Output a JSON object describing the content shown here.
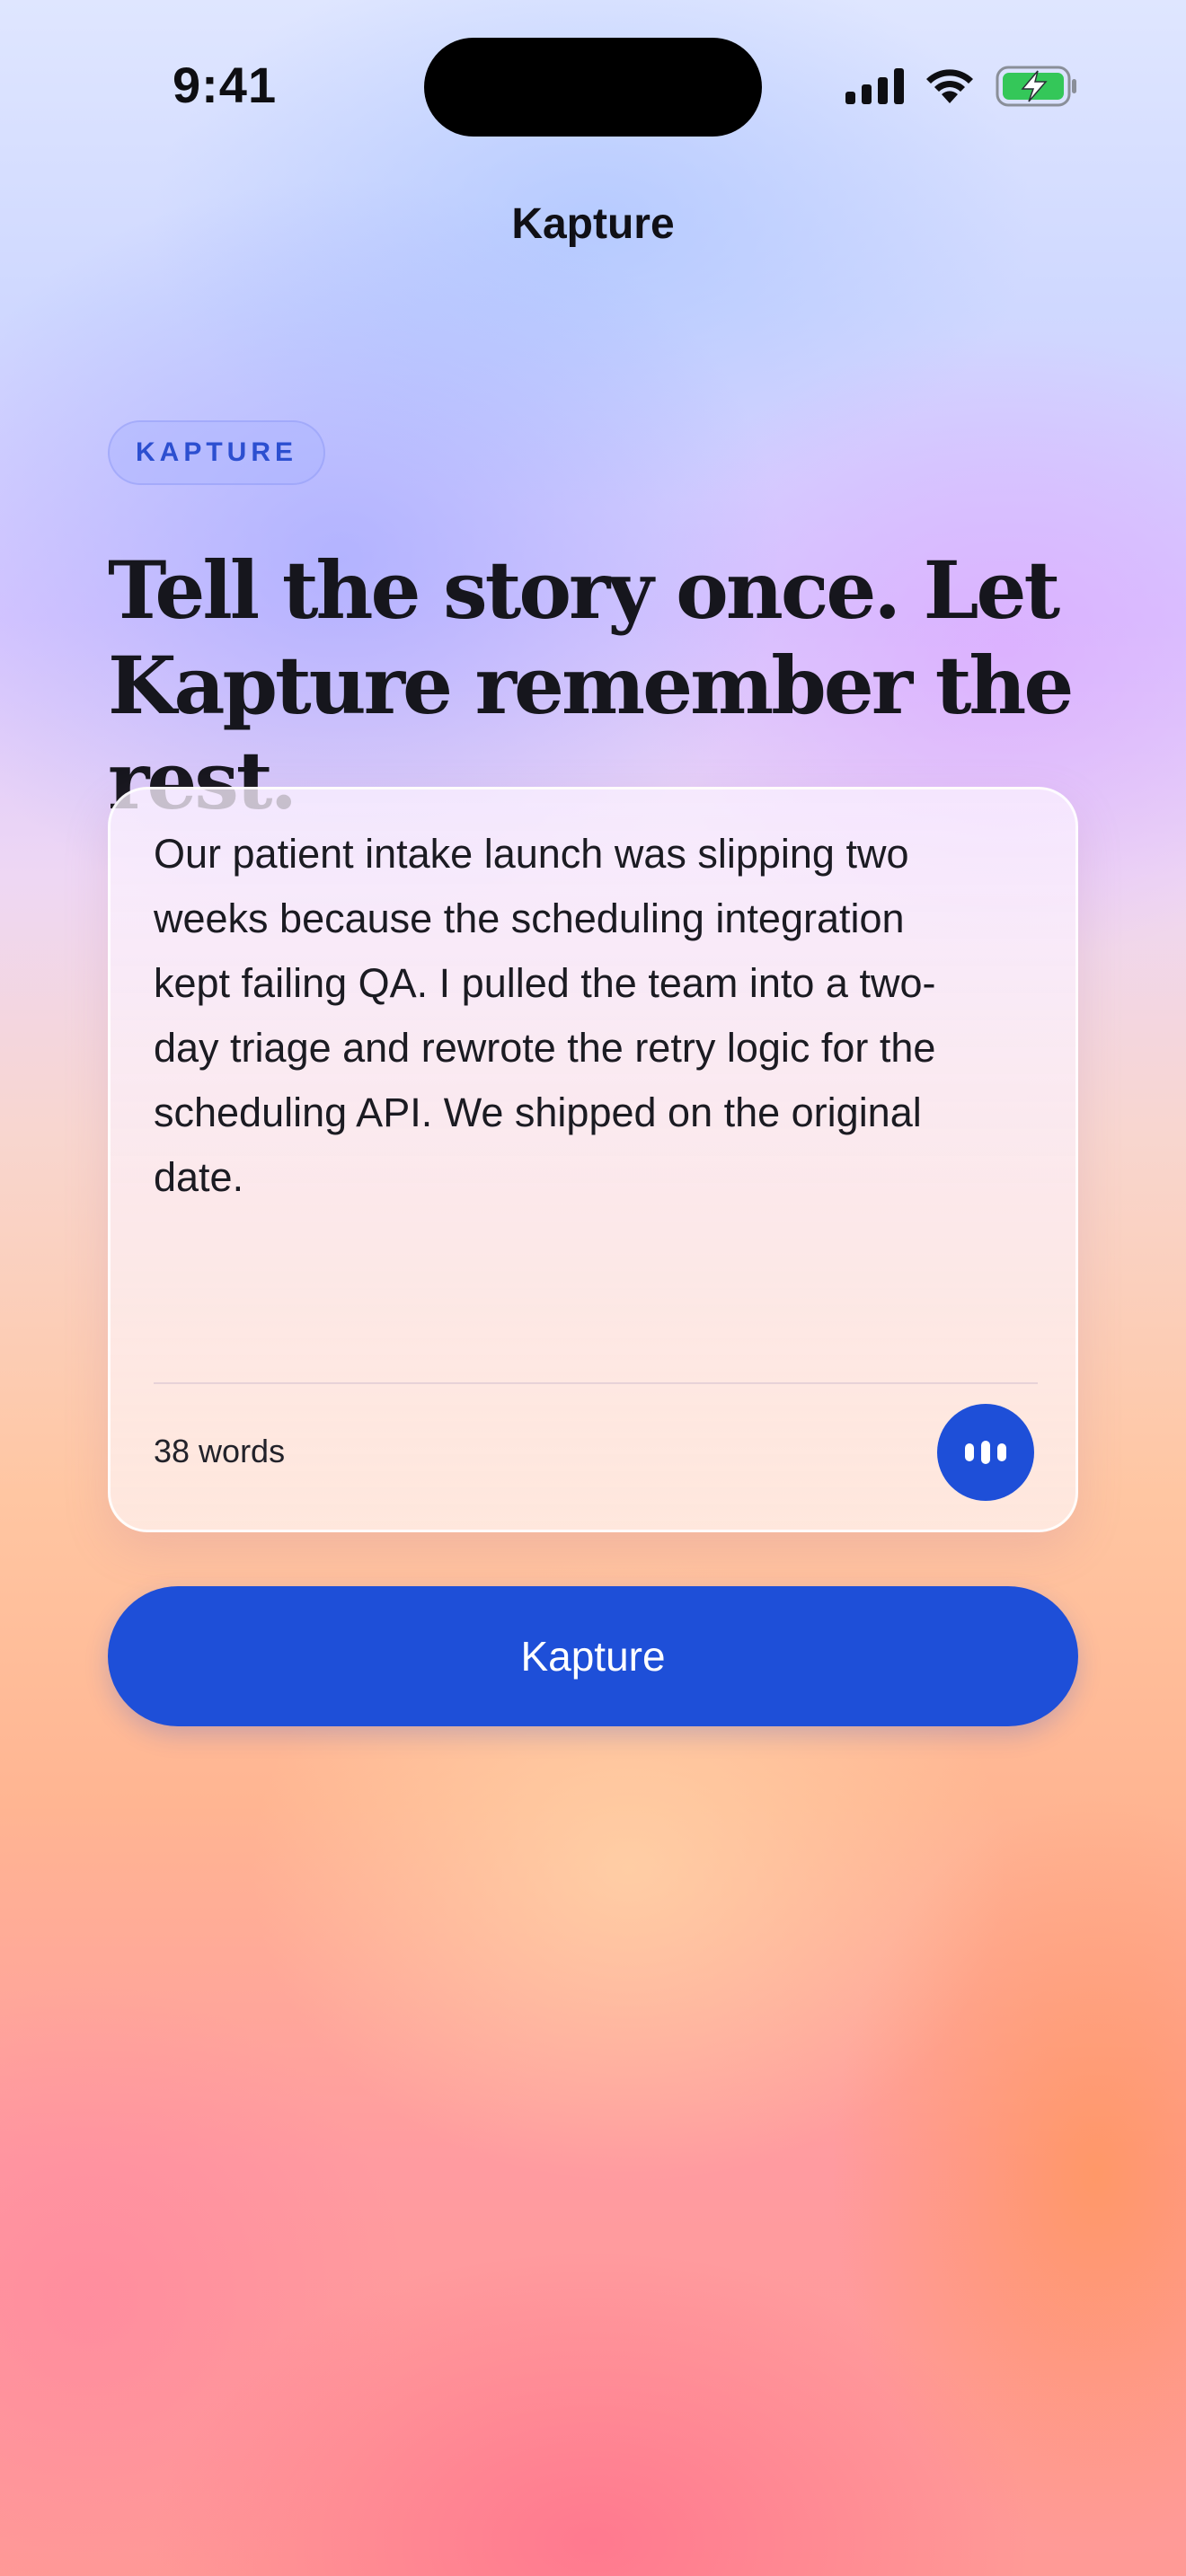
{
  "status_bar": {
    "time": "9:41"
  },
  "nav": {
    "title": "Kapture"
  },
  "badge": {
    "label": "KAPTURE"
  },
  "headline": "Tell the story once. Let\nKapture remember the rest.",
  "story_card": {
    "text": "Our patient intake launch was slipping two\nweeks because the scheduling integration\nkept failing QA. I pulled the team into a two-\nday triage and rewrote the retry logic for the\nscheduling API. We shipped on the original\ndate.",
    "word_count": "38 words",
    "voice_icon": "waveform-icon"
  },
  "primary_button": {
    "label": "Kapture"
  },
  "colors": {
    "accent": "#1e4fd8",
    "battery": "#34c759"
  }
}
